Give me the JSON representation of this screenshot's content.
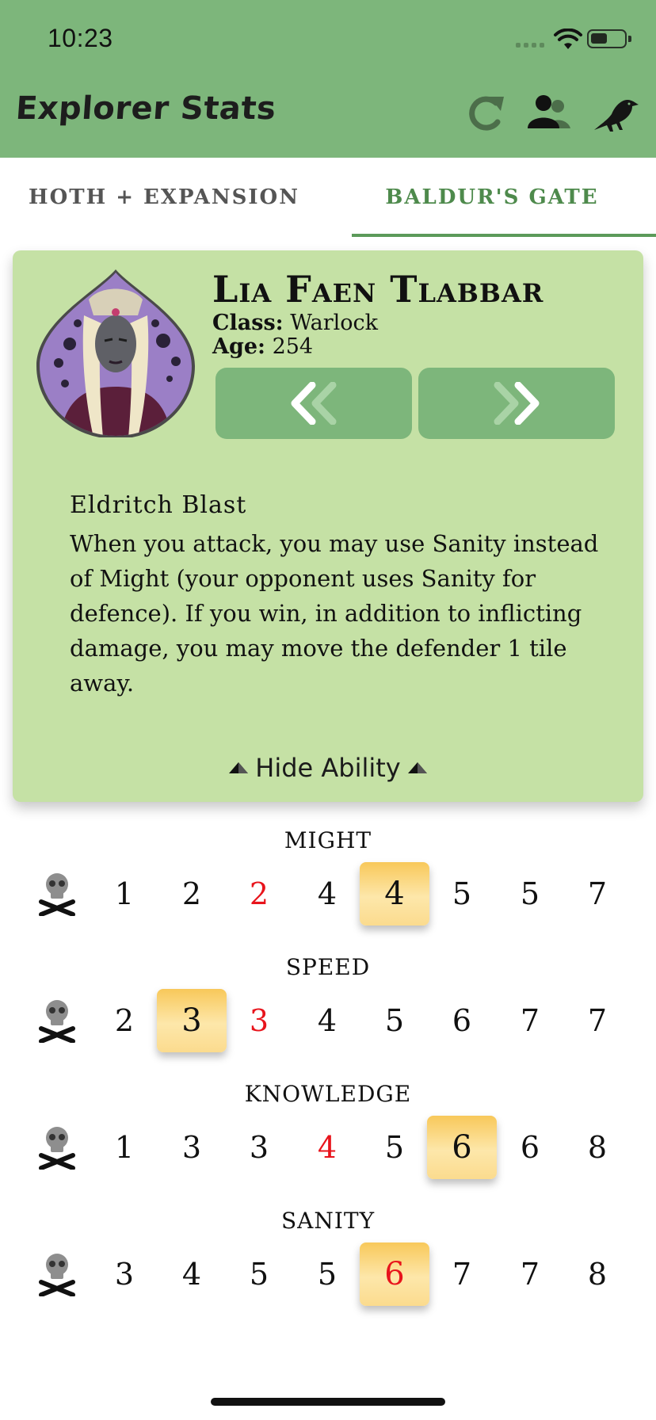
{
  "status_bar": {
    "time": "10:23"
  },
  "header": {
    "title": "Explorer Stats",
    "icons": [
      "refresh-icon",
      "group-icon",
      "raven-icon"
    ],
    "background_color": "#7db67b"
  },
  "tabs": [
    {
      "label": "HOTH + EXPANSION",
      "active": false
    },
    {
      "label": "BALDUR'S GATE",
      "active": true
    }
  ],
  "character": {
    "name": "Lia Faen Tlabbar",
    "class_label": "Class:",
    "class_value": "Warlock",
    "age_label": "Age:",
    "age_value": "254",
    "portrait": "portrait-image",
    "ability_title": "Eldritch Blast",
    "ability_text": "When you attack, you may use Sanity instead of Might (your opponent uses Sanity for defence). If you win, in addition to inflicting damage, you may move the defender 1 tile away.",
    "hide_ability_label": "Hide Ability",
    "card_color": "#c5e1a5"
  },
  "stats": [
    {
      "label": "MIGHT",
      "values": [
        "1",
        "2",
        "2",
        "4",
        "4",
        "5",
        "5",
        "7"
      ],
      "start_index": 2,
      "current_index": 4
    },
    {
      "label": "SPEED",
      "values": [
        "2",
        "3",
        "3",
        "4",
        "5",
        "6",
        "7",
        "7"
      ],
      "start_index": 2,
      "current_index": 1
    },
    {
      "label": "KNOWLEDGE",
      "values": [
        "1",
        "3",
        "3",
        "4",
        "5",
        "6",
        "6",
        "8"
      ],
      "start_index": 3,
      "current_index": 5
    },
    {
      "label": "SANITY",
      "values": [
        "3",
        "4",
        "5",
        "5",
        "6",
        "7",
        "7",
        "8"
      ],
      "start_index": 4,
      "current_index": 4
    }
  ],
  "colors": {
    "start_value": "#e8141c",
    "current_highlight": "#f8c85a",
    "active_tab": "#4e8a4c"
  }
}
